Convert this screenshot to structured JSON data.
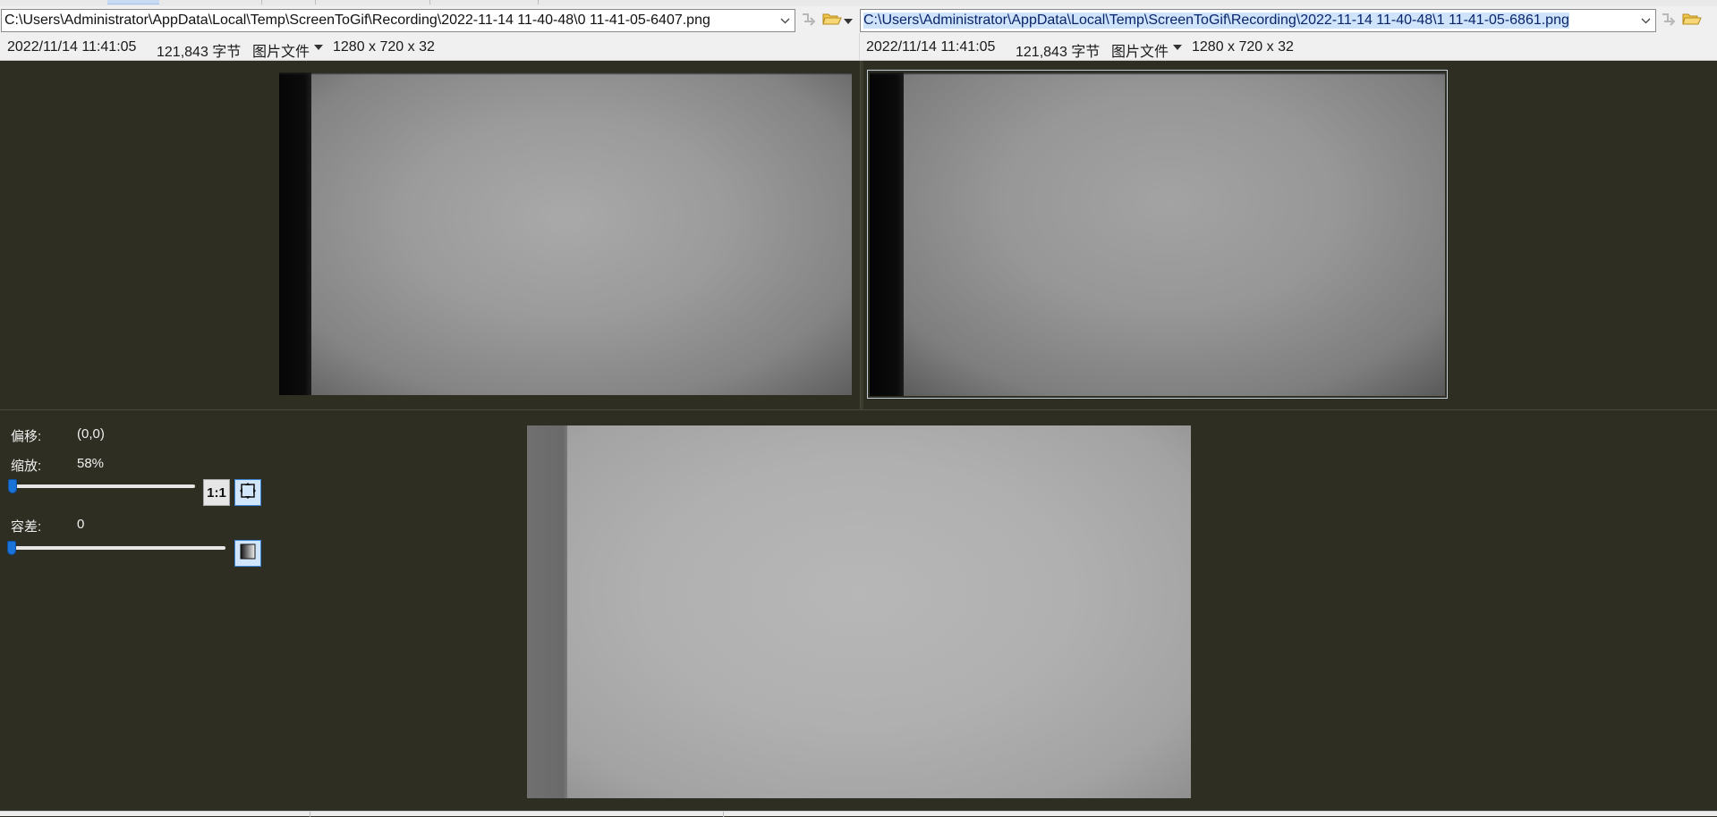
{
  "left_pane": {
    "path": "C:\\Users\\Administrator\\AppData\\Local\\Temp\\ScreenToGif\\Recording\\2022-11-14 11-40-48\\0 11-41-05-6407.png",
    "info": {
      "date": "2022/11/14 11:41:05",
      "size": "121,843 字节",
      "file_type": "图片文件",
      "dimensions": "1280 x 720 x 32"
    }
  },
  "right_pane": {
    "path": "C:\\Users\\Administrator\\AppData\\Local\\Temp\\ScreenToGif\\Recording\\2022-11-14 11-40-48\\1 11-41-05-6861.png",
    "info": {
      "date": "2022/11/14 11:41:05",
      "size": "121,843 字节",
      "file_type": "图片文件",
      "dimensions": "1280 x 720 x 32"
    }
  },
  "controls": {
    "offset_label": "偏移:",
    "offset_value": "(0,0)",
    "zoom_label": "缩放:",
    "zoom_value": "58%",
    "zoom_slider_level": 0,
    "one_to_one_label": "1:1",
    "tolerance_label": "容差:",
    "tolerance_value": "0",
    "tolerance_slider_level": 0
  },
  "icons": {
    "combo_dropdown": "chevron-down-icon",
    "next_file": "arrow-right-icon",
    "open_folder": "folder-icon",
    "fit_to_window": "fit-window-icon",
    "tolerance_mode": "gradient-square-icon"
  },
  "colors": {
    "viewer_background": "#2e2e22",
    "toolbar_background": "#f0f0f0",
    "selection_highlight": "#cfe4fb",
    "slider_thumb": "#1a73d9"
  }
}
